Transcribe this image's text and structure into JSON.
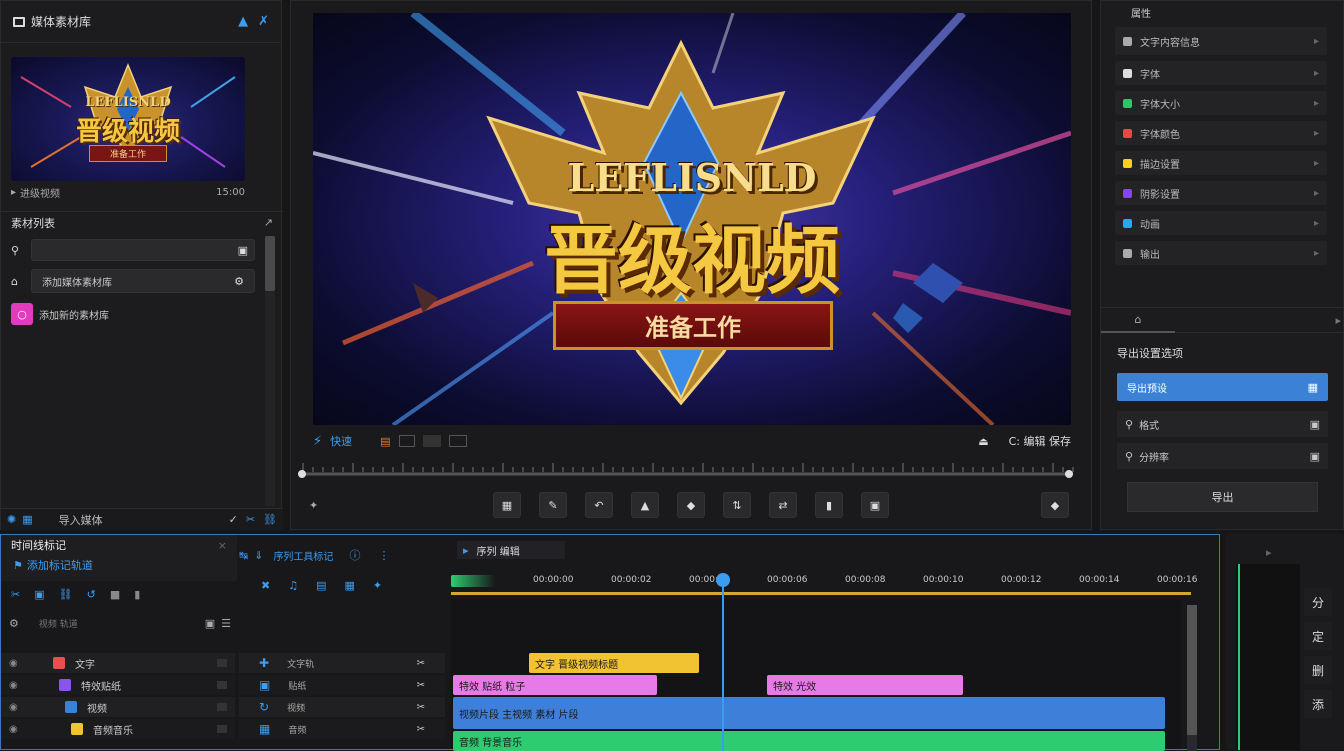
{
  "left_panel": {
    "title": "媒体素材库",
    "thumbnail_caption": "进级视频",
    "thumb_time": "15:00",
    "thumb_title_en": "LEFLISNLD",
    "thumb_title_cn": "晋级视频",
    "thumb_sub": "准备工作",
    "section_title": "素材列表",
    "search_placeholder": "",
    "item2_label": "添加媒体素材库",
    "item3_label": "添加新的素材库",
    "footer_label": "导入媒体"
  },
  "preview": {
    "title_en": "LEFLISNLD",
    "title_cn": "晋级视频",
    "subtitle": "准备工作",
    "toolbar_label": "快速",
    "timecode": "C: 编辑 保存"
  },
  "right_panel": {
    "title": "属性",
    "items": [
      {
        "label": "文字内容信息",
        "color": "#aaaaaa"
      },
      {
        "label": "字体",
        "color": "#dddddd"
      },
      {
        "label": "字体大小",
        "color": "#22cc66"
      },
      {
        "label": "字体颜色",
        "color": "#ee4444"
      },
      {
        "label": "描边设置",
        "color": "#ffcc22"
      },
      {
        "label": "阴影设置",
        "color": "#8844ee"
      },
      {
        "label": "动画",
        "color": "#22aaee"
      },
      {
        "label": "输出",
        "color": "#aaaaaa"
      }
    ],
    "section2_title": "导出设置选项",
    "export_items": [
      "导出预设",
      "格式",
      "分辨率"
    ],
    "export_button": "导出"
  },
  "timeline": {
    "left_title": "时间线标记",
    "left_subtitle": "添加标记轨道",
    "mid_title": "序列工具标记",
    "tab_label": "序列 编辑",
    "track_header": "视频 轨道",
    "ruler": [
      "00:00:00",
      "00:00:02",
      "00:00:04",
      "00:00:06",
      "00:00:08",
      "00:00:10",
      "00:00:12",
      "00:00:14",
      "00:00:16"
    ],
    "tracks": [
      {
        "name": "文字",
        "ctl": "文字轨"
      },
      {
        "name": "特效贴纸",
        "ctl": "贴纸"
      },
      {
        "name": "视频",
        "ctl": "视频"
      },
      {
        "name": "音频音乐",
        "ctl": "音频"
      }
    ],
    "clips": {
      "yellow": "文字 晋级视频标题",
      "pink1": "特效 贴纸 粒子",
      "pink2": "特效 光效",
      "blue": "视频片段 主视频 素材 片段",
      "green": "音频 背景音乐"
    },
    "right_tools": [
      "分",
      "定",
      "删",
      "添"
    ]
  },
  "colors": {
    "accent": "#2f8df0",
    "clip_yellow": "#f1c232",
    "clip_pink": "#e86fe8",
    "clip_blue": "#3d7fd9",
    "clip_green": "#2ecc71",
    "playhead": "#3b9cf0"
  }
}
